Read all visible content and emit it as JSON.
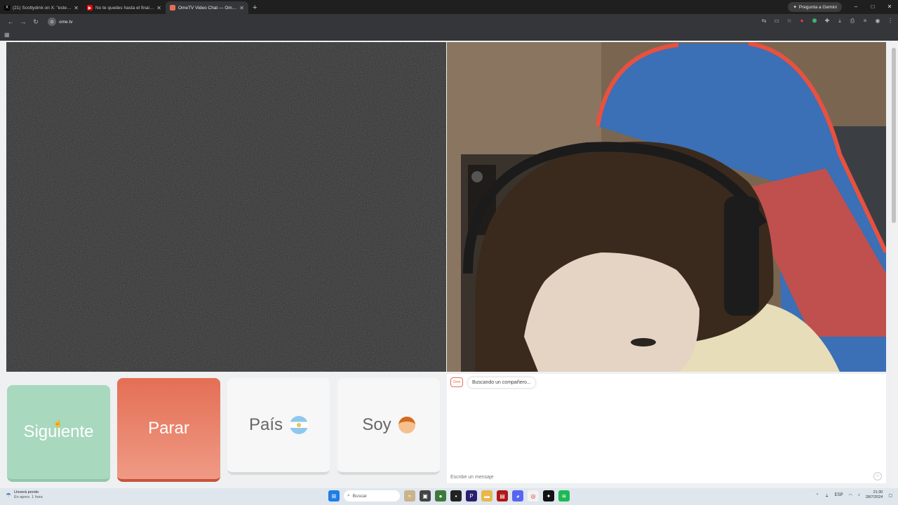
{
  "browser": {
    "tabs": [
      {
        "title": "(21) Scottydmk on X: \"este es d…",
        "favicon": "X",
        "color": "#000000",
        "active": false
      },
      {
        "title": "No te quedes hasta el final #g…",
        "favicon": "▶",
        "color": "#ff0000",
        "active": false
      },
      {
        "title": "OmeTV Video Chat — Ome…",
        "favicon": "●",
        "color": "#e46f55",
        "active": true
      }
    ],
    "new_tab": "+",
    "gemini_label": "Pregunta a Gemini",
    "url": "ome.tv",
    "window_controls": [
      "–",
      "□",
      "✕"
    ]
  },
  "app": {
    "buttons": {
      "next": "Siguiente",
      "stop": "Parar",
      "country": "País",
      "gender": "Soy"
    },
    "chat": {
      "logo": "Ome",
      "status_message": "Buscando un compañero...",
      "input_placeholder": "Escribe un mensaje"
    }
  },
  "taskbar": {
    "weather_title": "Lloverá pronto",
    "weather_sub": "En aprox. 1 hora",
    "search_label": "Buscar",
    "lang": "ESP",
    "time": "21:30",
    "date": "28/7/2024"
  }
}
